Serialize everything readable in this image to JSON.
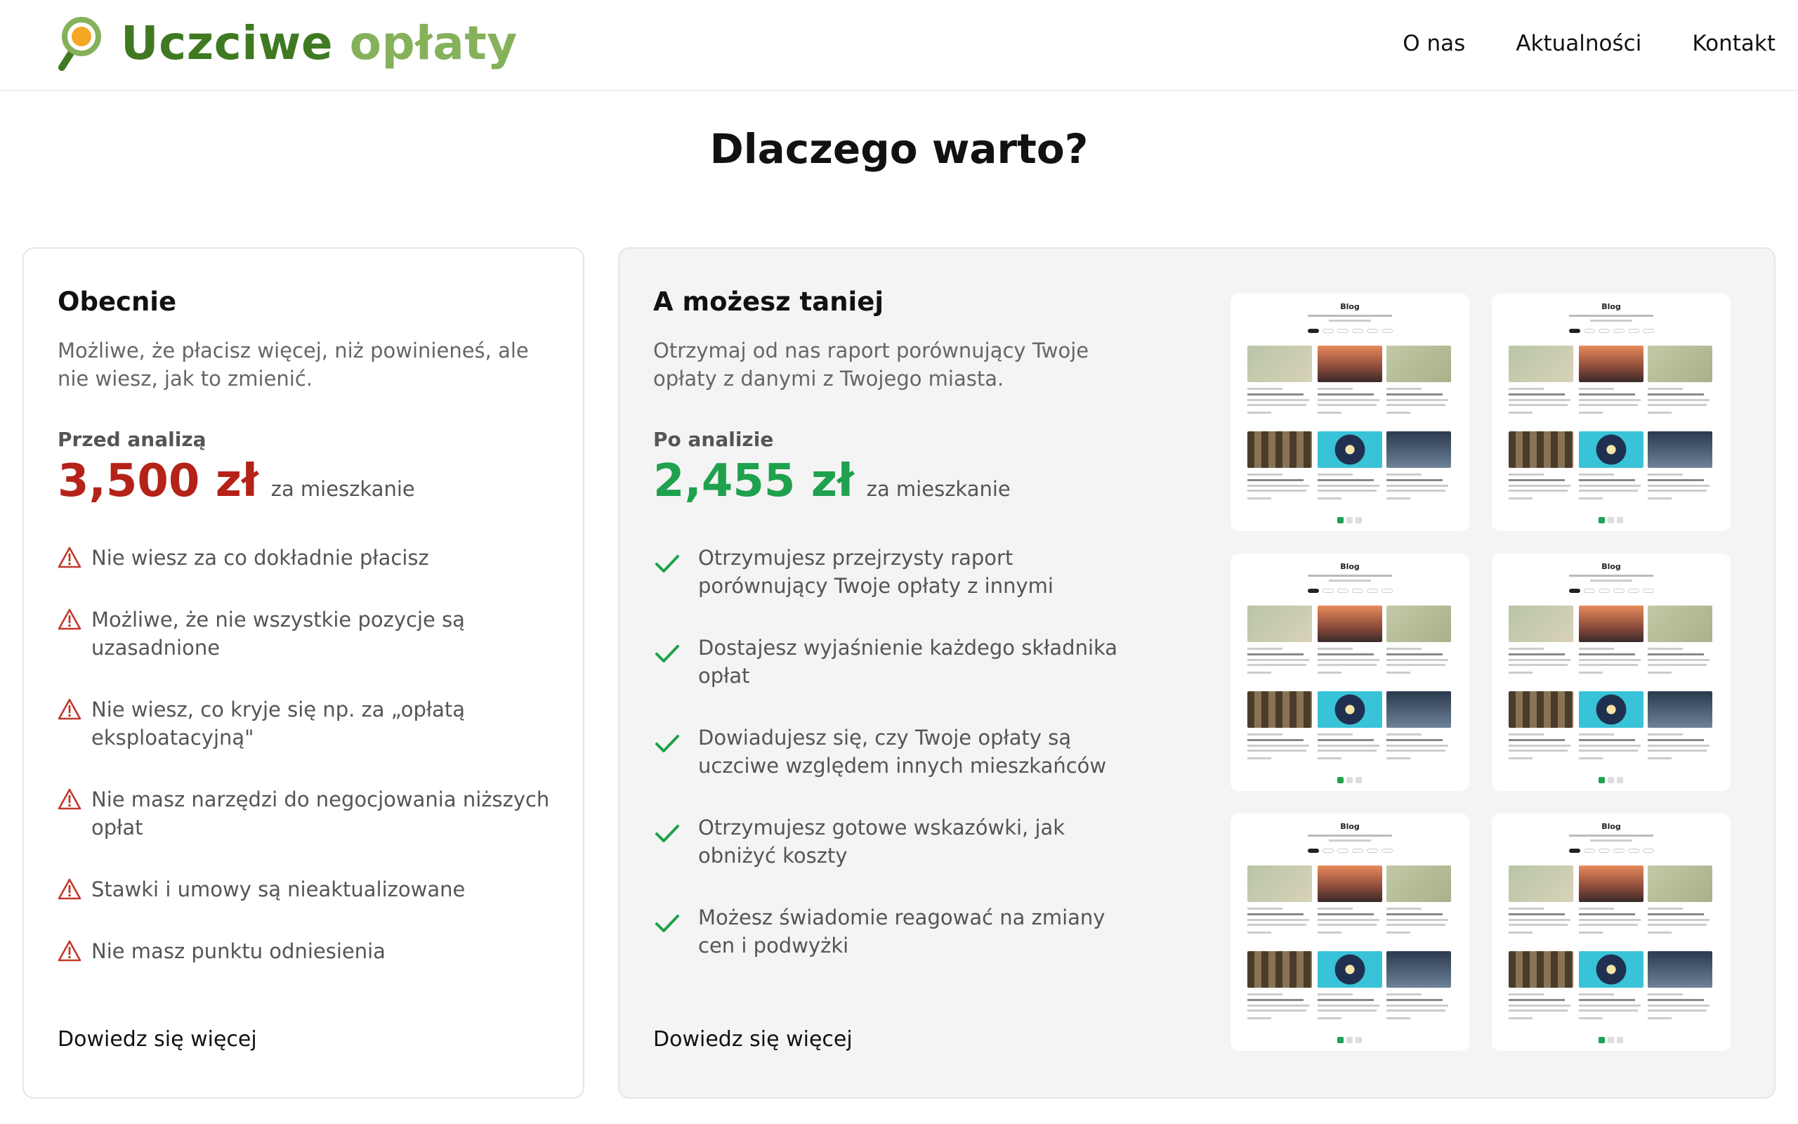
{
  "brand": {
    "word1": "Uczciwe",
    "word2": "opłaty"
  },
  "nav": [
    "O nas",
    "Aktualności",
    "Kontakt"
  ],
  "section_title": "Dlaczego warto?",
  "left_card": {
    "title": "Obecnie",
    "description": "Możliwe, że płacisz więcej, niż powinieneś, ale nie wiesz, jak to zmienić.",
    "price_label": "Przed analizą",
    "price": "3,500 zł",
    "price_unit": "za mieszkanie",
    "items": [
      "Nie wiesz za co dokładnie płacisz",
      "Możliwe, że nie wszystkie pozycje są uzasadnione",
      "Nie wiesz, co kryje się np. za „opłatą eksploatacyjną\"",
      "Nie masz narzędzi do negocjowania niższych opłat",
      "Stawki i umowy są nieaktualizowane",
      "Nie masz punktu odniesienia"
    ],
    "more_link": "Dowiedz się więcej",
    "icon": "warning-icon",
    "accent_color": "#b42318"
  },
  "right_card": {
    "title": "A możesz taniej",
    "description": "Otrzymaj od nas raport porównujący Twoje opłaty z danymi z Twojego miasta.",
    "price_label": "Po analizie",
    "price": "2,455 zł",
    "price_unit": "za mieszkanie",
    "items": [
      "Otrzymujesz przejrzysty raport porównujący Twoje opłaty z innymi",
      "Dostajesz wyjaśnienie każdego składnika opłat",
      "Dowiadujesz się, czy Twoje opłaty są uczciwe względem innych mieszkańców",
      "Otrzymujesz gotowe wskazówki, jak obniżyć koszty",
      "Możesz świadomie reagować na zmiany cen i podwyżki"
    ],
    "more_link": "Dowiedz się więcej",
    "icon": "check-icon",
    "accent_color": "#1fa14d"
  },
  "thumbnails": {
    "title": "Blog",
    "count": 6
  },
  "colors": {
    "brand_dark": "#3f7a22",
    "brand_light": "#86b15b",
    "logo_accent": "#f5a623"
  }
}
